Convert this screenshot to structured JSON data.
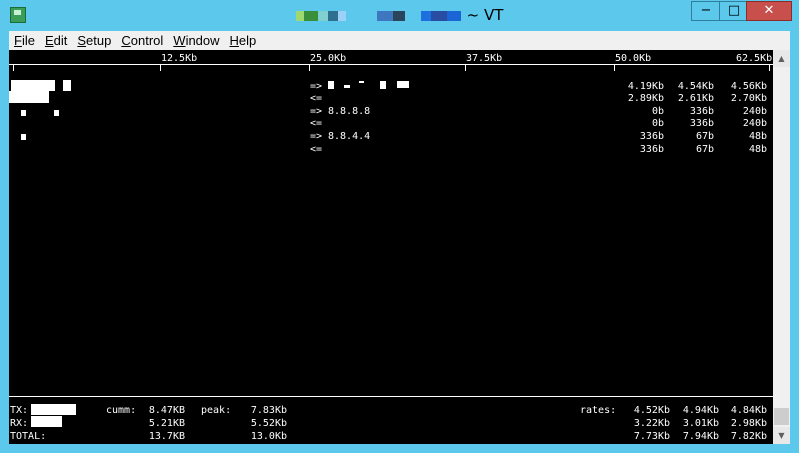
{
  "window": {
    "title": "~ VT",
    "minimize_glyph": "−",
    "maximize_glyph": "□",
    "close_glyph": "✕"
  },
  "menu": [
    {
      "label": "File"
    },
    {
      "label": "Edit"
    },
    {
      "label": "Setup"
    },
    {
      "label": "Control"
    },
    {
      "label": "Window"
    },
    {
      "label": "Help"
    }
  ],
  "scale": {
    "ticks": [
      "12.5Kb",
      "25.0Kb",
      "37.5Kb",
      "50.0Kb",
      "62.5Kb"
    ]
  },
  "connections": [
    {
      "dir": "=>",
      "host": "",
      "r2": "4.19Kb",
      "r10": "4.54Kb",
      "r40": "4.56Kb"
    },
    {
      "dir": "<=",
      "host": "",
      "r2": "2.89Kb",
      "r10": "2.61Kb",
      "r40": "2.70Kb"
    },
    {
      "dir": "=>",
      "host": "8.8.8.8",
      "r2": "0b",
      "r10": "336b",
      "r40": "240b"
    },
    {
      "dir": "<=",
      "host": "",
      "r2": "0b",
      "r10": "336b",
      "r40": "240b"
    },
    {
      "dir": "=>",
      "host": "8.8.4.4",
      "r2": "336b",
      "r10": "67b",
      "r40": "48b"
    },
    {
      "dir": "<=",
      "host": "",
      "r2": "336b",
      "r10": "67b",
      "r40": "48b"
    }
  ],
  "footer": {
    "labels": {
      "tx": "TX:",
      "rx": "RX:",
      "total": "TOTAL:",
      "cumm": "cumm:",
      "peak": "peak:",
      "rates": "rates:"
    },
    "tx": {
      "cumm": "8.47KB",
      "peak": "7.83Kb",
      "r2": "4.52Kb",
      "r10": "4.94Kb",
      "r40": "4.84Kb"
    },
    "rx": {
      "cumm": "5.21KB",
      "peak": "5.52Kb",
      "r2": "3.22Kb",
      "r10": "3.01Kb",
      "r40": "2.98Kb"
    },
    "total": {
      "cumm": "13.7KB",
      "peak": "13.0Kb",
      "r2": "7.73Kb",
      "r10": "7.94Kb",
      "r40": "7.82Kb"
    }
  },
  "colors": {
    "frame": "#5bc8ec",
    "terminal_bg": "#000000",
    "terminal_fg": "#ffffff",
    "close_button": "#c7504c"
  }
}
